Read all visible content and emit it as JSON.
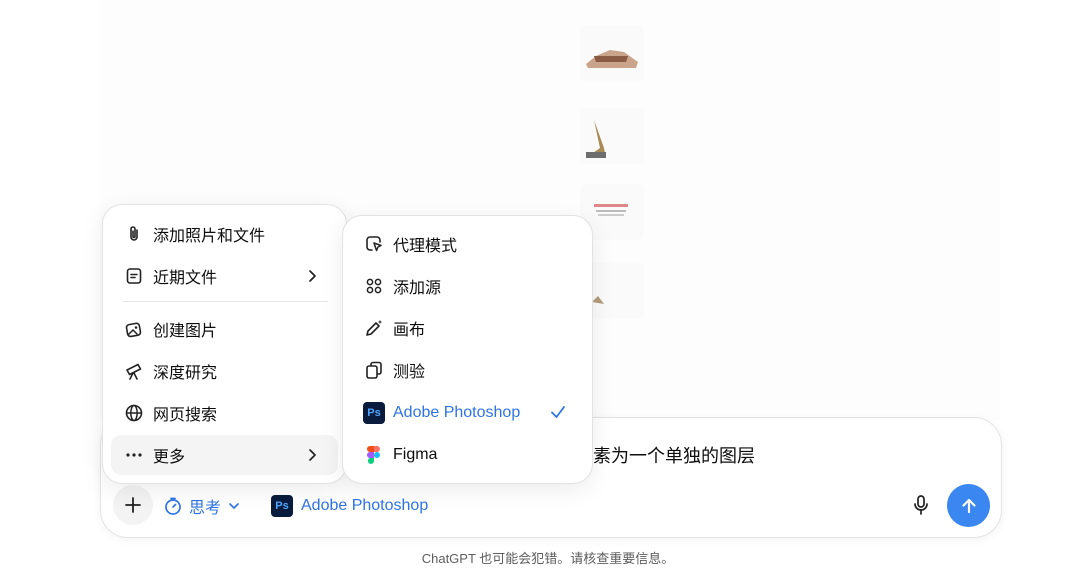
{
  "composer": {
    "text": "素为一个单独的图层",
    "think_label": "思考",
    "tool_label": "Adobe Photoshop",
    "ps_badge": "Ps"
  },
  "menu": {
    "items": [
      {
        "label": "添加照片和文件",
        "icon": "paperclip-icon"
      },
      {
        "label": "近期文件",
        "icon": "file-icon"
      },
      {
        "label": "创建图片",
        "icon": "image-create-icon"
      },
      {
        "label": "深度研究",
        "icon": "telescope-icon"
      },
      {
        "label": "网页搜索",
        "icon": "globe-icon"
      },
      {
        "label": "更多",
        "icon": "ellipsis-icon"
      }
    ]
  },
  "submenu": {
    "items": [
      {
        "label": "代理模式",
        "icon": "agent-cursor-icon"
      },
      {
        "label": "添加源",
        "icon": "apps-icon"
      },
      {
        "label": "画布",
        "icon": "pen-sparkle-icon"
      },
      {
        "label": "测验",
        "icon": "cards-icon"
      },
      {
        "label": "Adobe Photoshop",
        "icon": "photoshop-icon",
        "badge": "Ps",
        "selected": true
      },
      {
        "label": "Figma",
        "icon": "figma-icon"
      }
    ]
  },
  "footer": {
    "disclaimer": "ChatGPT 也可能会犯错。请核查重要信息。"
  },
  "colors": {
    "accent": "#2e74e6",
    "send": "#3a87f2",
    "ps_badge_bg": "#0a1c3d",
    "ps_badge_fg": "#4ea6ff"
  }
}
